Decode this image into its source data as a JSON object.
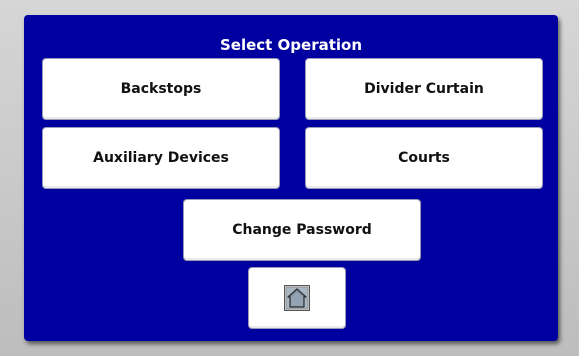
{
  "title": "Select Operation",
  "buttons": {
    "backstops": "Backstops",
    "divider_curtain": "Divider Curtain",
    "auxiliary_devices": "Auxiliary Devices",
    "courts": "Courts",
    "change_password": "Change Password"
  },
  "home": {
    "icon": "home-icon"
  },
  "colors": {
    "panel_background": "#0000a0",
    "button_background": "#ffffff",
    "title_text": "#ffffff"
  }
}
